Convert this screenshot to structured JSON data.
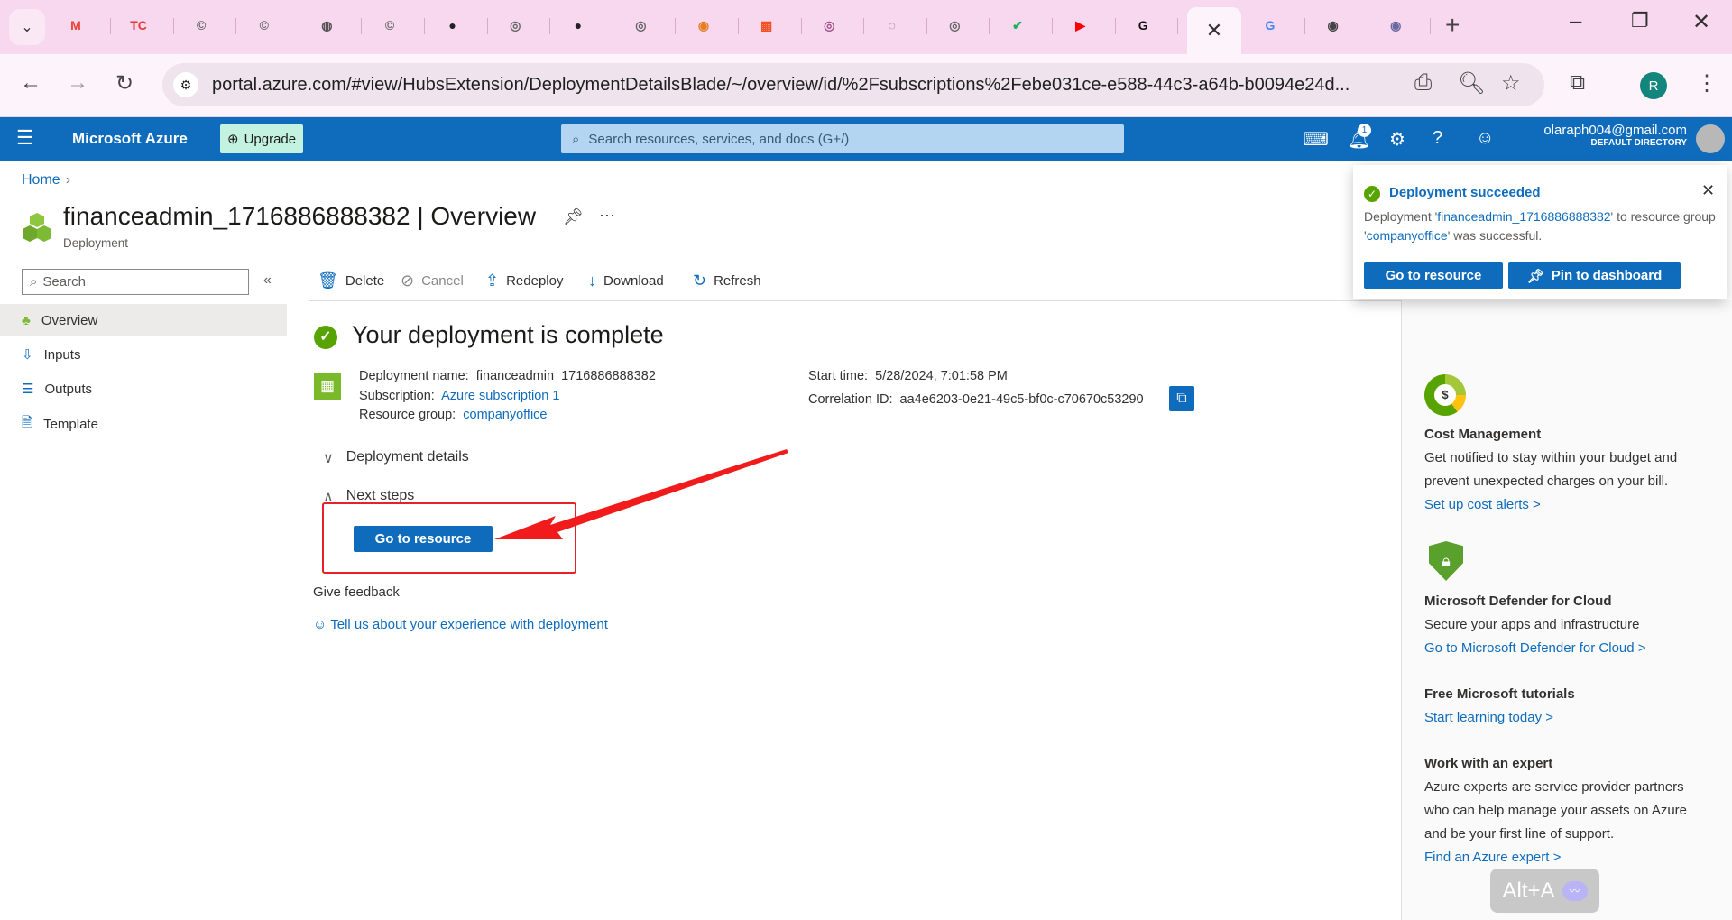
{
  "browser": {
    "tabs": [
      {
        "icon": "gmail-icon",
        "glyph": "M",
        "color": "#ea4335"
      },
      {
        "icon": "tc-icon",
        "glyph": "TC",
        "color": "#e53935"
      },
      {
        "icon": "site-icon",
        "glyph": "©",
        "color": "#666"
      },
      {
        "icon": "site-icon",
        "glyph": "©",
        "color": "#666"
      },
      {
        "icon": "globe-icon",
        "glyph": "◍",
        "color": "#555"
      },
      {
        "icon": "site-icon",
        "glyph": "©",
        "color": "#666"
      },
      {
        "icon": "github-icon",
        "glyph": "●",
        "color": "#222"
      },
      {
        "icon": "site-icon",
        "glyph": "◎",
        "color": "#666"
      },
      {
        "icon": "github-icon",
        "glyph": "●",
        "color": "#222"
      },
      {
        "icon": "site-icon",
        "glyph": "◎",
        "color": "#666"
      },
      {
        "icon": "colorful-icon",
        "glyph": "◉",
        "color": "#e67e22"
      },
      {
        "icon": "microsoft-icon",
        "glyph": "▦",
        "color": "#f25022"
      },
      {
        "icon": "site-icon",
        "glyph": "◎",
        "color": "#a0508a"
      },
      {
        "icon": "site-icon",
        "glyph": "◌",
        "color": "#666"
      },
      {
        "icon": "site-icon",
        "glyph": "◎",
        "color": "#666"
      },
      {
        "icon": "check-icon",
        "glyph": "✔",
        "color": "#18b35a"
      },
      {
        "icon": "youtube-icon",
        "glyph": "▶",
        "color": "#ff0000"
      },
      {
        "icon": "g-icon",
        "glyph": "G",
        "color": "#111"
      }
    ],
    "after_tabs": [
      {
        "icon": "google-icon",
        "glyph": "G",
        "color": "#4285f4"
      },
      {
        "icon": "site-icon",
        "glyph": "◉",
        "color": "#444"
      },
      {
        "icon": "site-icon",
        "glyph": "◉",
        "color": "#6a6aa0"
      }
    ],
    "active_tab_close": "✕",
    "new_tab": "+",
    "url": "portal.azure.com/#view/HubsExtension/DeploymentDetailsBlade/~/overview/id/%2Fsubscriptions%2Febe031ce-e588-44c3-a64b-b0094e24d...",
    "profile_initial": "R"
  },
  "azure": {
    "brand": "Microsoft Azure",
    "upgrade": "Upgrade",
    "search_placeholder": "Search resources, services, and docs (G+/)",
    "notification_count": "1",
    "account_email": "olaraph004@gmail.com",
    "account_directory": "DEFAULT DIRECTORY",
    "accent": "#0f6cbd"
  },
  "breadcrumb": {
    "home": "Home"
  },
  "page": {
    "title": "financeadmin_1716886888382 | Overview",
    "subtitle": "Deployment"
  },
  "sidebar": {
    "search_placeholder": "Search",
    "items": [
      {
        "label": "Overview",
        "icon": "deployment-icon"
      },
      {
        "label": "Inputs",
        "icon": "inputs-icon"
      },
      {
        "label": "Outputs",
        "icon": "outputs-icon"
      },
      {
        "label": "Template",
        "icon": "template-icon"
      }
    ]
  },
  "toolbar": {
    "delete": "Delete",
    "cancel": "Cancel",
    "redeploy": "Redeploy",
    "download": "Download",
    "refresh": "Refresh"
  },
  "main": {
    "heading": "Your deployment is complete",
    "deployment_name_label": "Deployment name:",
    "deployment_name": "financeadmin_1716886888382",
    "subscription_label": "Subscription:",
    "subscription": "Azure subscription 1",
    "resource_group_label": "Resource group:",
    "resource_group": "companyoffice",
    "start_time_label": "Start time:",
    "start_time": "5/28/2024, 7:01:58 PM",
    "correlation_label": "Correlation ID:",
    "correlation_id": "aa4e6203-0e21-49c5-bf0c-c70670c53290",
    "deployment_details": "Deployment details",
    "next_steps": "Next steps",
    "go_to_resource": "Go to resource",
    "give_feedback": "Give feedback",
    "feedback_link": "Tell us about your experience with deployment"
  },
  "right_panel": {
    "cost_title": "Cost Management",
    "cost_text_1": "Get notified to stay within your budget and",
    "cost_text_2": "prevent unexpected charges on your bill.",
    "cost_link": "Set up cost alerts >",
    "defender_title": "Microsoft Defender for Cloud",
    "defender_text": "Secure your apps and infrastructure",
    "defender_link": "Go to Microsoft Defender for Cloud >",
    "tutorials_title": "Free Microsoft tutorials",
    "tutorials_link": "Start learning today >",
    "expert_title": "Work with an expert",
    "expert_text_1": "Azure experts are service provider partners",
    "expert_text_2": "who can help manage your assets on Azure",
    "expert_text_3": "and be your first line of support.",
    "expert_link": "Find an Azure expert >"
  },
  "toast": {
    "title": "Deployment succeeded",
    "text_prefix": "Deployment '",
    "deployment": "financeadmin_1716886888382",
    "text_mid": "' to resource group '",
    "group": "companyoffice",
    "text_suffix": "' was successful.",
    "go_to_resource": "Go to resource",
    "pin": "Pin to dashboard"
  },
  "overlay": {
    "shortcut": "Alt+A"
  }
}
